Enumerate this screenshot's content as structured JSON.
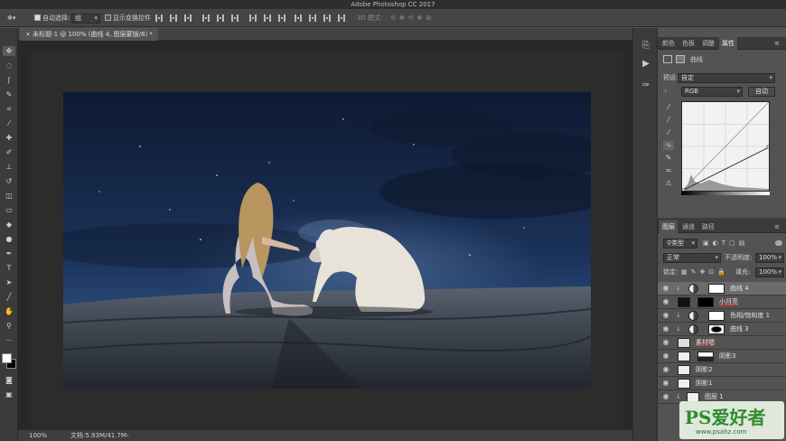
{
  "app": {
    "title": "Adobe Photoshop CC 2017"
  },
  "options_bar": {
    "auto_select_label": "自动选择:",
    "auto_select_value": "组",
    "show_transform_label": "显示变换控件",
    "mode_3d_label": "3D 模式:"
  },
  "document": {
    "tab_label": "未标题-1 @ 100% (曲线 4, 图层蒙版/8) *",
    "zoom": "100%",
    "doc_size": "文档:5.93M/41.7M"
  },
  "properties_panel": {
    "tabs": [
      "颜色",
      "色板",
      "调整",
      "属性"
    ],
    "active_tab": "属性",
    "adjustment_name": "曲线",
    "preset_label": "预设:",
    "preset_value": "自定",
    "channel_value": "RGB",
    "auto_button": "自动"
  },
  "layers_panel": {
    "tabs": [
      "图层",
      "通道",
      "路径"
    ],
    "active_tab": "图层",
    "filter_value": "类型",
    "blend_mode": "正常",
    "opacity_label": "不透明度:",
    "opacity_value": "100%",
    "lock_label": "锁定:",
    "fill_label": "填充:",
    "fill_value": "100%",
    "layers": [
      {
        "name": "曲线 4",
        "selected": true,
        "kind": "adjustment"
      },
      {
        "name": "小月亮",
        "selected": false,
        "kind": "smart"
      },
      {
        "name": "色相/饱和度 1",
        "selected": false,
        "kind": "adjustment"
      },
      {
        "name": "曲线 3",
        "selected": false,
        "kind": "adjustment"
      },
      {
        "name": "素材嗯",
        "selected": false,
        "kind": "smart"
      },
      {
        "name": "阴影3",
        "selected": false,
        "kind": "pixel"
      },
      {
        "name": "阴影2",
        "selected": false,
        "kind": "pixel"
      },
      {
        "name": "阴影1",
        "selected": false,
        "kind": "pixel"
      },
      {
        "name": "图层 1",
        "selected": false,
        "kind": "pixel"
      }
    ]
  },
  "watermark": {
    "text": "PS爱好者",
    "url": "www.psahz.com"
  },
  "colors": {
    "ui_dark": "#535353",
    "sky_top": "#0f1c36",
    "sky_horizon": "#2a4a78",
    "rock": "#3d4652"
  }
}
